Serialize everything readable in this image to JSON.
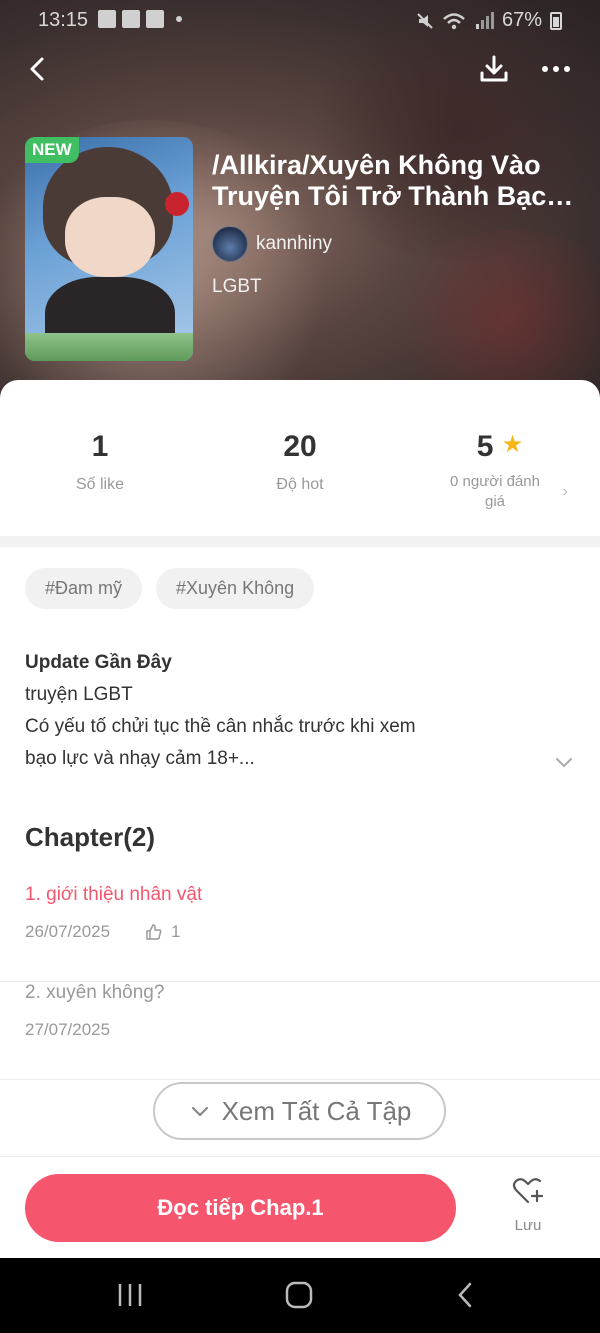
{
  "status_bar": {
    "time": "13:15",
    "battery": "67%"
  },
  "story": {
    "badge": "NEW",
    "title_line1": "/Allkira/Xuyên Không Vào",
    "title_line2": "Truyện Tôi Trở Thành Bạch ...",
    "author": "kannhiny",
    "genre": "LGBT"
  },
  "stats": [
    {
      "value": "1",
      "label": "Số like"
    },
    {
      "value": "20",
      "label": "Độ hot"
    },
    {
      "value": "5",
      "label": "0 người đánh giá"
    }
  ],
  "tags": [
    "#Đam mỹ",
    "#Xuyên Không"
  ],
  "description": {
    "heading": "Update Gần Đây",
    "lines": [
      "truyện LGBT",
      "Có yếu tố chửi tục thề cân nhắc trước khi xem",
      "bạo lực và nhạy cảm 18+..."
    ]
  },
  "chapters_heading": "Chapter(2)",
  "chapters": [
    {
      "title": "1. giới thiệu nhân vật",
      "date": "26/07/2025",
      "likes": "1"
    },
    {
      "title": "2. xuyên không?",
      "date": "27/07/2025"
    }
  ],
  "see_all_label": "Xem Tất Cả Tập",
  "read_button_label": "Đọc tiếp Chap.1",
  "save_label": "Lưu",
  "colors": {
    "accent": "#f5566e",
    "new_badge": "#3fbf62",
    "star": "#f7b718"
  },
  "icons": [
    "back-arrow-icon",
    "download-icon",
    "more-icon",
    "star-icon",
    "chevron-down-icon",
    "thumbs-up-icon",
    "heart-plus-icon"
  ]
}
